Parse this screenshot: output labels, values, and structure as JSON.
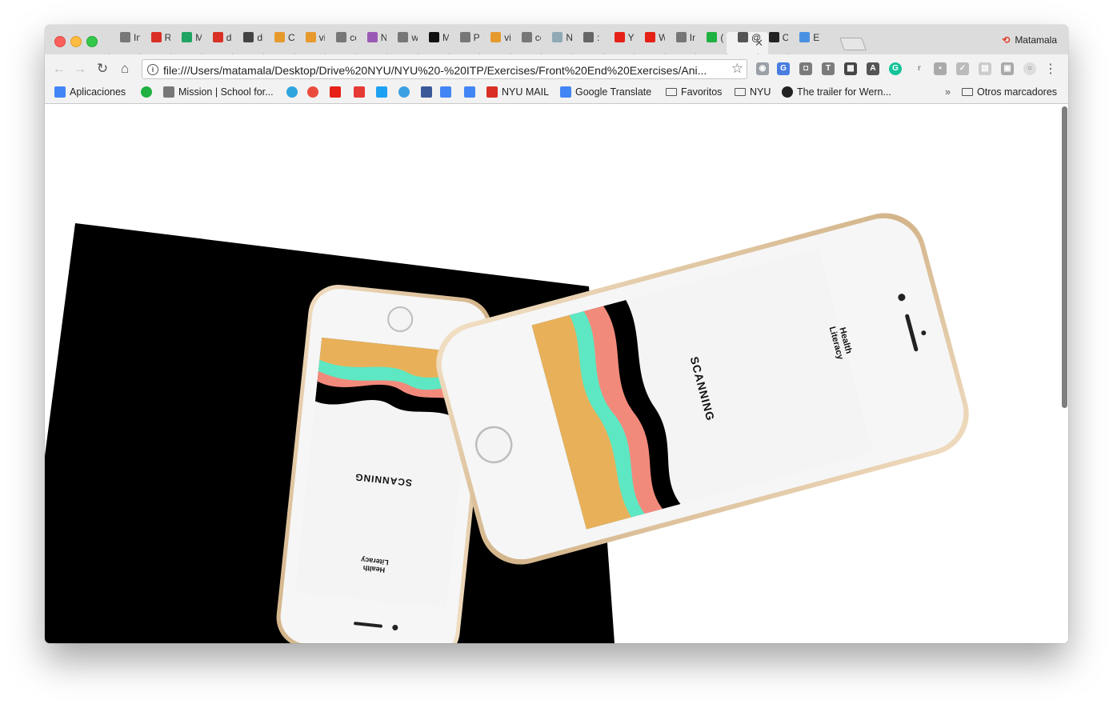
{
  "window": {
    "profile_name": "Matamala"
  },
  "tabs": [
    {
      "label": "In",
      "icon": "doc-icon",
      "color": "#777777"
    },
    {
      "label": "R",
      "icon": "gmail-icon",
      "color": "#d93025"
    },
    {
      "label": "M",
      "icon": "drive-icon",
      "color": "#1fa463"
    },
    {
      "label": "d",
      "icon": "gmail-icon",
      "color": "#d93025"
    },
    {
      "label": "di",
      "icon": "bomb-icon",
      "color": "#444444"
    },
    {
      "label": "C",
      "icon": "image-icon",
      "color": "#e69a2e"
    },
    {
      "label": "vi",
      "icon": "image-icon",
      "color": "#e69a2e"
    },
    {
      "label": "cc",
      "icon": "doc-icon",
      "color": "#777777"
    },
    {
      "label": "N",
      "icon": "avatar-icon",
      "color": "#9b59b6"
    },
    {
      "label": "w",
      "icon": "doc-icon",
      "color": "#777777"
    },
    {
      "label": "M",
      "icon": "medium-icon",
      "color": "#111111"
    },
    {
      "label": "Pi",
      "icon": "doc-icon",
      "color": "#777777"
    },
    {
      "label": "vi",
      "icon": "image-icon",
      "color": "#e69a2e"
    },
    {
      "label": "cc",
      "icon": "doc-icon",
      "color": "#777777"
    },
    {
      "label": "N",
      "icon": "globe-icon",
      "color": "#8fa9b5"
    },
    {
      "label": ":",
      "icon": "square-icon",
      "color": "#666666"
    },
    {
      "label": "Yo",
      "icon": "youtube-icon",
      "color": "#e62117"
    },
    {
      "label": "W",
      "icon": "youtube-icon",
      "color": "#e62117"
    },
    {
      "label": "In",
      "icon": "doc-icon",
      "color": "#777777"
    },
    {
      "label": "(",
      "icon": "badge-icon",
      "color": "#1fb141"
    },
    {
      "label": "@",
      "icon": "at-icon",
      "color": "#555555",
      "active": true
    },
    {
      "label": "C",
      "icon": "cube-icon",
      "color": "#222222"
    },
    {
      "label": "Ec",
      "icon": "cloud-icon",
      "color": "#4a90e2"
    }
  ],
  "omnibox": {
    "url": "file:///Users/matamala/Desktop/Drive%20NYU/NYU%20-%20ITP/Exercises/Front%20End%20Exercises/Ani..."
  },
  "bookmarks": [
    {
      "label": "Aplicaciones",
      "icon": "apps-grid-icon",
      "color": "#4285f4"
    },
    {
      "label": "",
      "icon": "badge-icon",
      "color": "#1fb141"
    },
    {
      "label": "Mission | School for...",
      "icon": "doc-icon",
      "color": "#777777"
    },
    {
      "label": "",
      "icon": "telegram-icon",
      "color": "#2ea6dd"
    },
    {
      "label": "",
      "icon": "circle-b-icon",
      "color": "#ea4c3c"
    },
    {
      "label": "",
      "icon": "youtube-icon",
      "color": "#e62117"
    },
    {
      "label": "",
      "icon": "x-icon",
      "color": "#e53935"
    },
    {
      "label": "",
      "icon": "twitter-icon",
      "color": "#1da1f2"
    },
    {
      "label": "",
      "icon": "swirl-icon",
      "color": "#3aa0e0"
    },
    {
      "label": "",
      "icon": "facebook-icon",
      "color": "#3b5998"
    },
    {
      "label": "",
      "icon": "ads-icon",
      "color": "#4285f4"
    },
    {
      "label": "",
      "icon": "google-icon",
      "color": "#4285f4"
    },
    {
      "label": "NYU MAIL",
      "icon": "gmail-icon",
      "color": "#d93025"
    },
    {
      "label": "Google Translate",
      "icon": "translate-icon",
      "color": "#4285f4"
    },
    {
      "label": "Favoritos",
      "icon": "folder-icon",
      "color": "#555555"
    },
    {
      "label": "NYU",
      "icon": "folder-icon",
      "color": "#555555"
    },
    {
      "label": "The trailer for Wern...",
      "icon": "av-icon",
      "color": "#222222"
    }
  ],
  "bookmarks_overflow": "»",
  "other_bookmarks": "Otros marcadores",
  "page": {
    "phone_left": {
      "title": "SCANNING",
      "brand_line1": "Health",
      "brand_line2": "Literacy"
    },
    "phone_right": {
      "title": "SCANNING",
      "brand_line1": "Health",
      "brand_line2": "Literacy"
    },
    "colors": {
      "orange": "#e9b05a",
      "teal": "#5de8c3",
      "coral": "#f28a7c",
      "black": "#000000",
      "gold": "#d9b990"
    }
  }
}
